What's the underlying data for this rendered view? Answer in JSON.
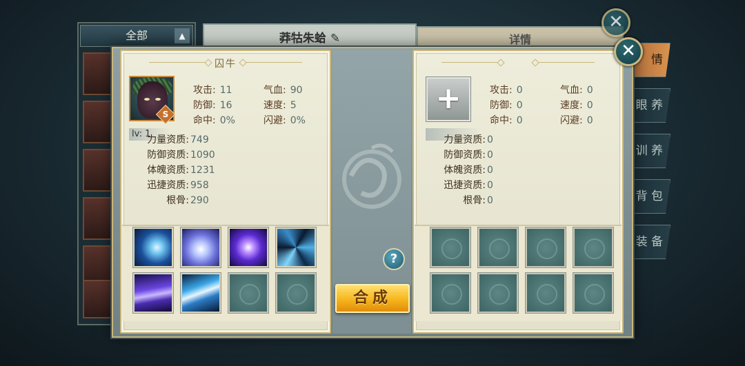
{
  "background": {
    "list_filter_label": "全部",
    "tab_name_label": "莽牯朱蛤",
    "tab_detail_label": "详情",
    "side_tabs": [
      "情",
      "眼 养",
      "训 养",
      "背 包",
      "装 备"
    ]
  },
  "left_panel": {
    "title": "囚牛",
    "rank": "S",
    "level_text": "lv: 1",
    "stats": [
      {
        "label": "攻击:",
        "value": "11"
      },
      {
        "label": "气血:",
        "value": "90"
      },
      {
        "label": "防御:",
        "value": "16"
      },
      {
        "label": "速度:",
        "value": "5"
      },
      {
        "label": "命中:",
        "value": "0%"
      },
      {
        "label": "闪避:",
        "value": "0%"
      }
    ],
    "aptitudes": [
      {
        "label": "力量资质:",
        "value": "749"
      },
      {
        "label": "防御资质:",
        "value": "1090"
      },
      {
        "label": "体魄资质:",
        "value": "1231"
      },
      {
        "label": "迅捷资质:",
        "value": "958"
      },
      {
        "label": "根骨:",
        "value": "290"
      }
    ],
    "skills": [
      "wind-slash-skill-icon",
      "vortex-skill-icon",
      "lightning-orb-skill-icon",
      "ice-shards-skill-icon",
      "purple-pillar-skill-icon",
      "light-dash-skill-icon",
      "empty",
      "empty"
    ]
  },
  "right_panel": {
    "add_symbol": "+",
    "stats": [
      {
        "label": "攻击:",
        "value": "0"
      },
      {
        "label": "气血:",
        "value": "0"
      },
      {
        "label": "防御:",
        "value": "0"
      },
      {
        "label": "速度:",
        "value": "0"
      },
      {
        "label": "命中:",
        "value": "0"
      },
      {
        "label": "闪避:",
        "value": "0"
      }
    ],
    "aptitudes": [
      {
        "label": "力量资质:",
        "value": "0"
      },
      {
        "label": "防御资质:",
        "value": "0"
      },
      {
        "label": "体魄资质:",
        "value": "0"
      },
      {
        "label": "迅捷资质:",
        "value": "0"
      },
      {
        "label": "根骨:",
        "value": "0"
      }
    ]
  },
  "center": {
    "help_symbol": "?",
    "combine_label": "合成"
  },
  "close_symbol": "✕",
  "colors": {
    "accent_gold": "#c9b67a",
    "button_gold": "#f6b51c",
    "panel_bg": "#eeeddb"
  }
}
